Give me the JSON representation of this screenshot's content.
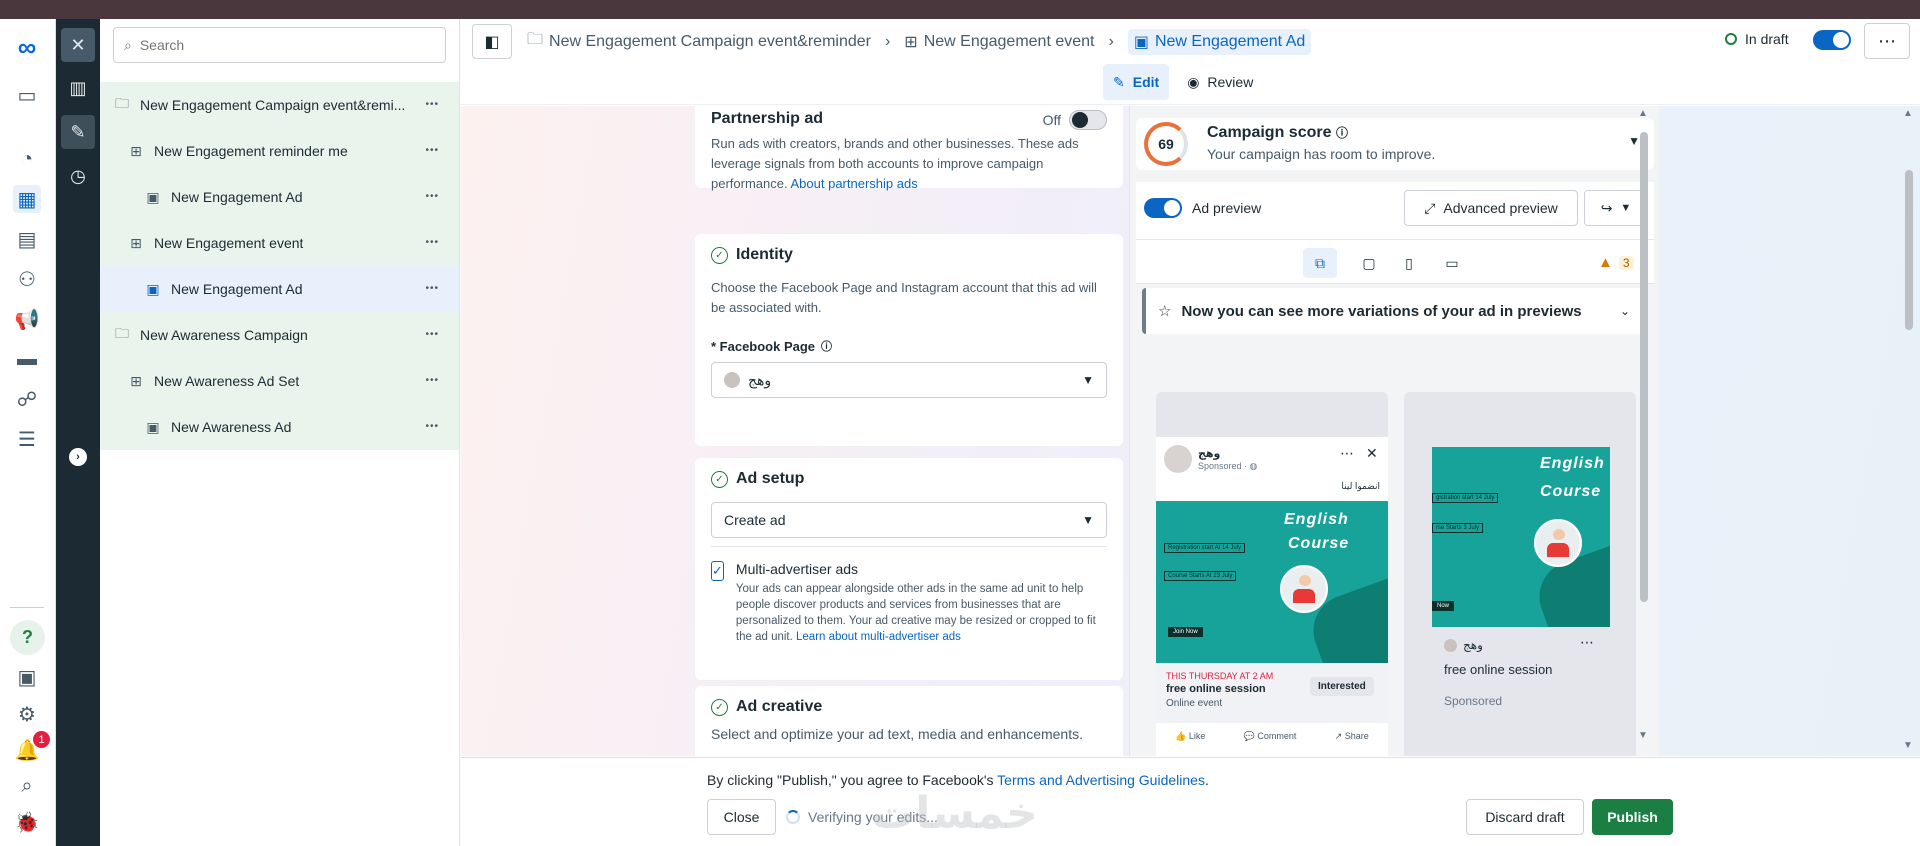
{
  "nav": {
    "notification_count": "1",
    "help_label": "?"
  },
  "search": {
    "placeholder": "Search"
  },
  "tree": [
    {
      "label": "New Engagement Campaign event&remi...",
      "level": 0,
      "icon": "folder-icon"
    },
    {
      "label": "New Engagement reminder me",
      "level": 1,
      "icon": "grid-icon"
    },
    {
      "label": "New Engagement Ad",
      "level": 2,
      "icon": "ad-icon"
    },
    {
      "label": "New Engagement event",
      "level": 1,
      "icon": "grid-icon"
    },
    {
      "label": "New Engagement Ad",
      "level": 2,
      "icon": "ad-icon",
      "selected": true
    },
    {
      "label": "New Awareness Campaign",
      "level": 0,
      "icon": "folder-icon"
    },
    {
      "label": "New Awareness Ad Set",
      "level": 1,
      "icon": "grid-icon"
    },
    {
      "label": "New Awareness Ad",
      "level": 2,
      "icon": "ad-icon"
    }
  ],
  "header": {
    "crumb_campaign": "New Engagement Campaign event&reminder",
    "crumb_adset": "New Engagement event",
    "crumb_ad": "New Engagement Ad",
    "status": "In draft",
    "edit_label": "Edit",
    "review_label": "Review"
  },
  "partnership": {
    "title": "Partnership ad",
    "toggle_label": "Off",
    "description": "Run ads with creators, brands and other businesses. These ads leverage signals from both accounts to improve campaign performance.",
    "link": "About partnership ads"
  },
  "identity": {
    "title": "Identity",
    "description": "Choose the Facebook Page and Instagram account that this ad will be associated with.",
    "page_label": "* Facebook Page",
    "page_value": "وهج"
  },
  "ad_setup": {
    "title": "Ad setup",
    "select_value": "Create ad",
    "multi_title": "Multi-advertiser ads",
    "multi_desc": "Your ads can appear alongside other ads in the same ad unit to help people discover products and services from businesses that are personalized to them. Your ad creative may be resized or cropped to fit the ad unit.",
    "multi_link": "Learn about multi-advertiser ads"
  },
  "ad_creative": {
    "title": "Ad creative",
    "description": "Select and optimize your ad text, media and enhancements."
  },
  "score": {
    "value": "69",
    "title": "Campaign score",
    "subtitle": "Your campaign has room to improve."
  },
  "preview": {
    "toggle_label": "Ad preview",
    "advanced_label": "Advanced preview",
    "warning_count": "3",
    "variations_text": "Now you can see more variations of your ad in previews"
  },
  "post1": {
    "page_name": "وهج",
    "sponsored": "Sponsored · ",
    "caption": "انضموا لينا",
    "creative_title_1": "English",
    "creative_title_2": "Course",
    "box1": "Registration start At 14 July",
    "box2": "Course Starts At 23 July",
    "join": "Join Now",
    "event_date": "THIS THURSDAY AT 2 AM",
    "event_name": "free online session",
    "event_type": "Online event",
    "interested": "Interested",
    "like": "Like",
    "comment": "Comment",
    "share": "Share"
  },
  "post2": {
    "creative_title_1": "English",
    "creative_title_2": "Course",
    "box1": "gistration start 14 July",
    "box2": "rse Starts 3 July",
    "join": "Now",
    "page_name": "وهج",
    "event_name": "free online session",
    "sponsored": "Sponsored"
  },
  "footer": {
    "agree_text": "By clicking \"Publish,\" you agree to Facebook's ",
    "agree_link": "Terms and Advertising Guidelines",
    "agree_end": ".",
    "close_label": "Close",
    "verifying": "Verifying your edits...",
    "discard_label": "Discard draft",
    "publish_label": "Publish",
    "watermark": "خمسات"
  }
}
